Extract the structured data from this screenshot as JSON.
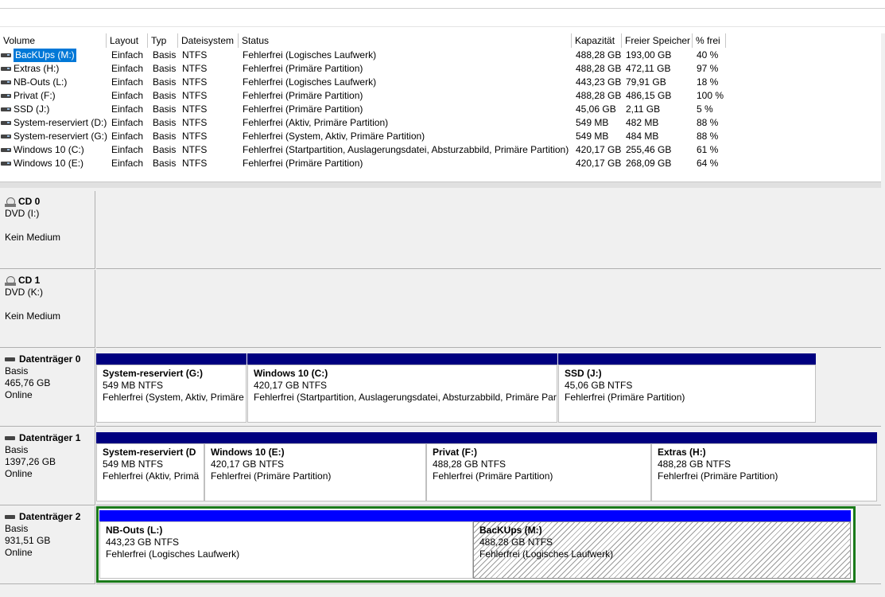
{
  "colors": {
    "primary_bar": "#00007f",
    "logical_bar": "#0000ff",
    "extended_border": "#1a7a1a",
    "selection": "#0078d7"
  },
  "volume_list": {
    "columns": [
      "Volume",
      "Layout",
      "Typ",
      "Dateisystem",
      "Status",
      "Kapazität",
      "Freier Speicher",
      "% frei"
    ],
    "rows": [
      {
        "volume": "BacKUps (M:)",
        "layout": "Einfach",
        "typ": "Basis",
        "fs": "NTFS",
        "status": "Fehlerfrei (Logisches Laufwerk)",
        "capacity": "488,28 GB",
        "free": "193,00 GB",
        "pct": "40 %",
        "selected": true
      },
      {
        "volume": "Extras (H:)",
        "layout": "Einfach",
        "typ": "Basis",
        "fs": "NTFS",
        "status": "Fehlerfrei (Primäre Partition)",
        "capacity": "488,28 GB",
        "free": "472,11 GB",
        "pct": "97 %"
      },
      {
        "volume": "NB-Outs (L:)",
        "layout": "Einfach",
        "typ": "Basis",
        "fs": "NTFS",
        "status": "Fehlerfrei (Logisches Laufwerk)",
        "capacity": "443,23 GB",
        "free": "79,91 GB",
        "pct": "18 %"
      },
      {
        "volume": "Privat (F:)",
        "layout": "Einfach",
        "typ": "Basis",
        "fs": "NTFS",
        "status": "Fehlerfrei (Primäre Partition)",
        "capacity": "488,28 GB",
        "free": "486,15 GB",
        "pct": "100 %"
      },
      {
        "volume": "SSD (J:)",
        "layout": "Einfach",
        "typ": "Basis",
        "fs": "NTFS",
        "status": "Fehlerfrei (Primäre Partition)",
        "capacity": "45,06 GB",
        "free": "2,11 GB",
        "pct": "5 %"
      },
      {
        "volume": "System-reserviert (D:)",
        "layout": "Einfach",
        "typ": "Basis",
        "fs": "NTFS",
        "status": "Fehlerfrei (Aktiv, Primäre Partition)",
        "capacity": "549 MB",
        "free": "482 MB",
        "pct": "88 %"
      },
      {
        "volume": "System-reserviert (G:)",
        "layout": "Einfach",
        "typ": "Basis",
        "fs": "NTFS",
        "status": "Fehlerfrei (System, Aktiv, Primäre Partition)",
        "capacity": "549 MB",
        "free": "484 MB",
        "pct": "88 %"
      },
      {
        "volume": "Windows 10 (C:)",
        "layout": "Einfach",
        "typ": "Basis",
        "fs": "NTFS",
        "status": "Fehlerfrei (Startpartition, Auslagerungsdatei, Absturzabbild, Primäre Partition)",
        "capacity": "420,17 GB",
        "free": "255,46 GB",
        "pct": "61 %"
      },
      {
        "volume": "Windows 10 (E:)",
        "layout": "Einfach",
        "typ": "Basis",
        "fs": "NTFS",
        "status": "Fehlerfrei (Primäre Partition)",
        "capacity": "420,17 GB",
        "free": "268,09 GB",
        "pct": "64 %"
      }
    ]
  },
  "disks": [
    {
      "title": "CD 0",
      "lines": [
        "DVD (I:)"
      ],
      "note": "Kein Medium",
      "icon": "cd-drive-icon",
      "partitions": []
    },
    {
      "title": "CD 1",
      "lines": [
        "DVD (K:)"
      ],
      "note": "Kein Medium",
      "icon": "cd-drive-icon",
      "partitions": []
    },
    {
      "title": "Datenträger 0",
      "lines": [
        "Basis",
        "465,76 GB",
        "Online"
      ],
      "icon": "hard-disk-icon",
      "partitions": [
        {
          "name": "System-reserviert  (G:)",
          "size": "549 MB NTFS",
          "status": "Fehlerfrei (System, Aktiv, Primäre"
        },
        {
          "name": "Windows 10  (C:)",
          "size": "420,17 GB NTFS",
          "status": "Fehlerfrei (Startpartition, Auslagerungsdatei, Absturzabbild, Primäre Par"
        },
        {
          "name": "SSD  (J:)",
          "size": "45,06 GB NTFS",
          "status": "Fehlerfrei (Primäre Partition)"
        }
      ]
    },
    {
      "title": "Datenträger 1",
      "lines": [
        "Basis",
        "1397,26 GB",
        "Online"
      ],
      "icon": "hard-disk-icon",
      "partitions": [
        {
          "name": "System-reserviert  (D",
          "size": "549 MB NTFS",
          "status": "Fehlerfrei (Aktiv, Primä"
        },
        {
          "name": "Windows 10  (E:)",
          "size": "420,17 GB NTFS",
          "status": "Fehlerfrei (Primäre Partition)"
        },
        {
          "name": "Privat  (F:)",
          "size": "488,28 GB NTFS",
          "status": "Fehlerfrei (Primäre Partition)"
        },
        {
          "name": "Extras  (H:)",
          "size": "488,28 GB NTFS",
          "status": "Fehlerfrei (Primäre Partition)"
        }
      ]
    },
    {
      "title": "Datenträger 2",
      "lines": [
        "Basis",
        "931,51 GB",
        "Online"
      ],
      "icon": "hard-disk-icon",
      "partitions": [
        {
          "name": "NB-Outs  (L:)",
          "size": "443,23 GB NTFS",
          "status": "Fehlerfrei (Logisches Laufwerk)"
        },
        {
          "name": "BacKUps  (M:)",
          "size": "488,28 GB NTFS",
          "status": "Fehlerfrei (Logisches Laufwerk)",
          "selected": true
        }
      ]
    }
  ]
}
